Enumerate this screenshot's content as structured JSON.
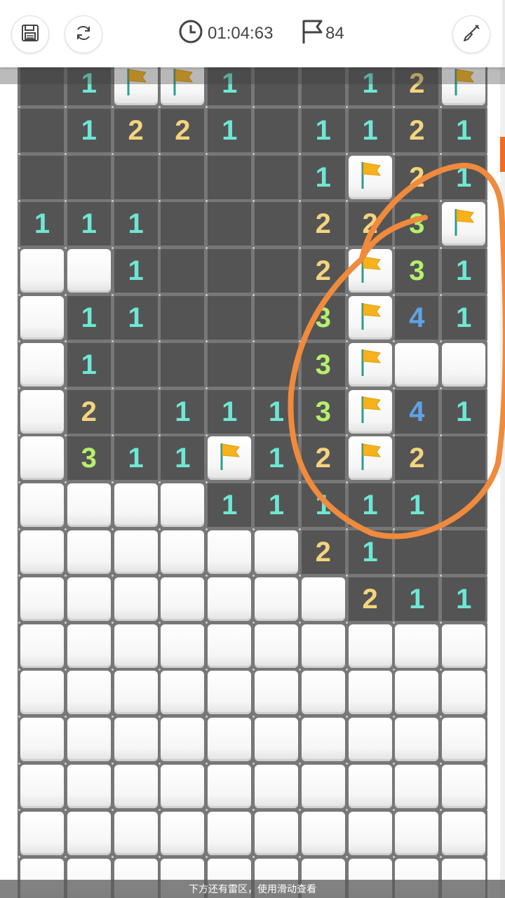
{
  "toolbar": {
    "timer": "01:04:63",
    "flags": "84",
    "save_icon": "save-icon",
    "restart_icon": "refresh-icon",
    "shovel_icon": "shovel-icon"
  },
  "hint": "下方还有雷区，使用滑动查看",
  "colors": {
    "1": "#6ee7d3",
    "2": "#f4d47e",
    "3": "#b5f06c",
    "4": "#5fa3e6",
    "accent": "#f26a1b",
    "annotation": "#f08a3c"
  },
  "board": {
    "columns": 10,
    "rows": [
      [
        ".",
        "1",
        "F",
        "F",
        "1",
        ".",
        ".",
        "1",
        "2",
        "F"
      ],
      [
        ".",
        "1",
        "2",
        "2",
        "1",
        ".",
        "1",
        "1",
        "2",
        "1"
      ],
      [
        ".",
        ".",
        ".",
        ".",
        ".",
        ".",
        "1",
        "F",
        "2",
        "1"
      ],
      [
        "1",
        "1",
        "1",
        ".",
        ".",
        ".",
        "2",
        "2",
        "3",
        "F"
      ],
      [
        "#",
        "#",
        "1",
        ".",
        ".",
        ".",
        "2",
        "F",
        "3",
        "1"
      ],
      [
        "#",
        "1",
        "1",
        ".",
        ".",
        ".",
        "3",
        "F",
        "4",
        "1"
      ],
      [
        "#",
        "1",
        ".",
        ".",
        ".",
        ".",
        "3",
        "F",
        "#",
        "#"
      ],
      [
        "#",
        "2",
        ".",
        "1",
        "1",
        "1",
        "3",
        "F",
        "4",
        "1"
      ],
      [
        "#",
        "3",
        "1",
        "1",
        "F",
        "1",
        "2",
        "F",
        "2",
        "."
      ],
      [
        "#",
        "#",
        "#",
        "#",
        "1",
        "1",
        "1",
        "1",
        "1",
        "."
      ],
      [
        "#",
        "#",
        "#",
        "#",
        "#",
        "#",
        "2",
        "1",
        ".",
        "."
      ],
      [
        "#",
        "#",
        "#",
        "#",
        "#",
        "#",
        "#",
        "2",
        "1",
        "1"
      ],
      [
        "#",
        "#",
        "#",
        "#",
        "#",
        "#",
        "#",
        "#",
        "#",
        "#"
      ],
      [
        "#",
        "#",
        "#",
        "#",
        "#",
        "#",
        "#",
        "#",
        "#",
        "#"
      ],
      [
        "#",
        "#",
        "#",
        "#",
        "#",
        "#",
        "#",
        "#",
        "#",
        "#"
      ],
      [
        "#",
        "#",
        "#",
        "#",
        "#",
        "#",
        "#",
        "#",
        "#",
        "#"
      ],
      [
        "#",
        "#",
        "#",
        "#",
        "#",
        "#",
        "#",
        "#",
        "#",
        "#"
      ],
      [
        "#",
        "#",
        "#",
        "#",
        "#",
        "#",
        "#",
        "#",
        "#",
        "#"
      ]
    ]
  }
}
